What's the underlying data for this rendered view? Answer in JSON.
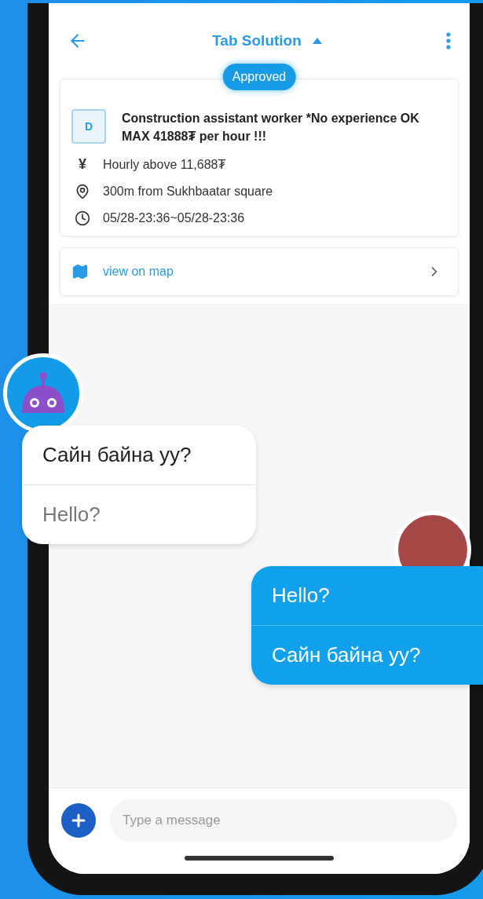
{
  "header": {
    "title": "Tab Solution"
  },
  "job": {
    "status": "Approved",
    "logo_letter": "D",
    "title": "Construction assistant worker *No experience OK MAX 41888₮ per hour !!!",
    "details": [
      {
        "kind": "pay",
        "icon": "¥",
        "text": "Hourly above 11,688₮"
      },
      {
        "kind": "location",
        "text": "300m from Sukhbaatar square"
      },
      {
        "kind": "time",
        "text": "05/28-23:36~05/28-23:36"
      }
    ]
  },
  "map_link": {
    "label": "view on map"
  },
  "messages": [
    {
      "kind": "incoming",
      "lines": [
        "Сайн байна уу?",
        "Hello?"
      ]
    },
    {
      "kind": "outgoing",
      "lines": [
        "Hello?",
        "Сайн байна уу?"
      ]
    }
  ],
  "composer": {
    "placeholder": "Type a message"
  }
}
